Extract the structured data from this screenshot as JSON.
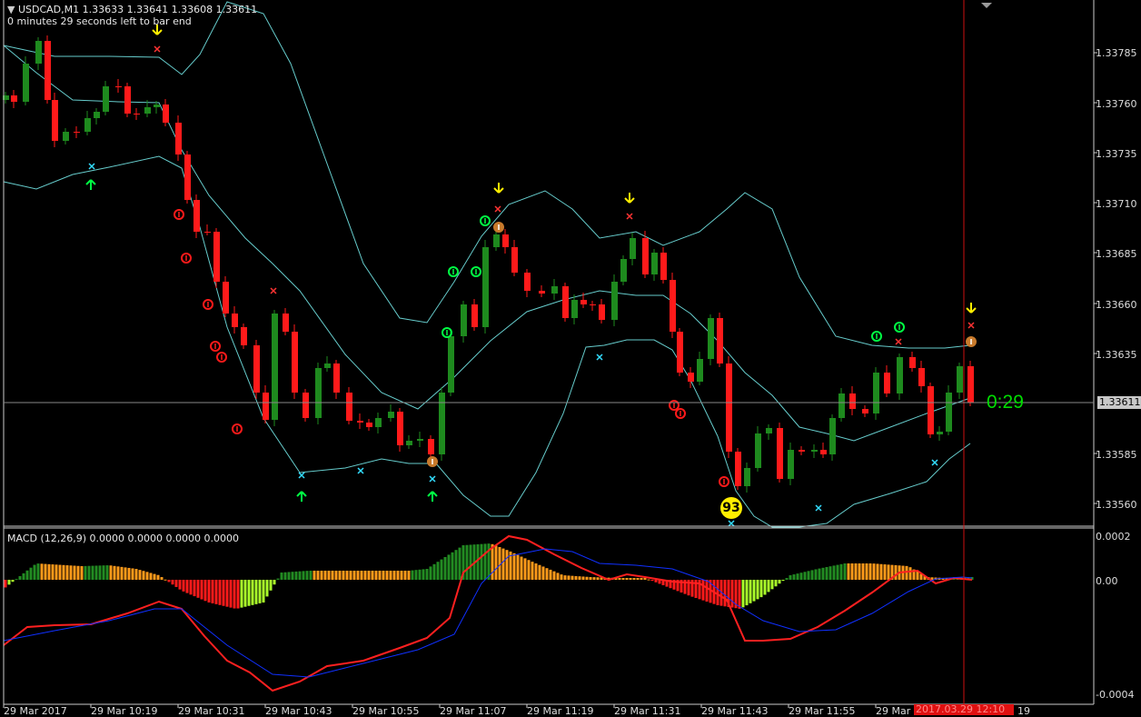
{
  "header": {
    "symbol_line": "USDCAD,M1  1.33633 1.33641 1.33608 1.33611",
    "countdown_text": "0 minutes 29 seconds left to bar end"
  },
  "price_scale": {
    "labels": [
      "1.33785",
      "1.33760",
      "1.33735",
      "1.33710",
      "1.33685",
      "1.33660",
      "1.33635",
      "1.33585",
      "1.33560"
    ],
    "current_price": "1.33611"
  },
  "timer_text": "0:29",
  "signal_badge": "93",
  "macd": {
    "label": "MACD (12,26,9) 0.0000 0.0000 0.0000 0.0000",
    "scale_labels": [
      "0.0002",
      "0.00",
      "-0.0004"
    ],
    "colors": {
      "up_strong": "#228B22",
      "up_weak": "#ff9a1a",
      "down_strong": "#ff1a1a",
      "down_weak": "#aaff2a",
      "signal_red": "#ff2020",
      "signal_blue": "#1030ff"
    }
  },
  "time_axis": {
    "labels": [
      "29 Mar 2017",
      "29 Mar 10:19",
      "29 Mar 10:31",
      "29 Mar 10:43",
      "29 Mar 10:55",
      "29 Mar 11:07",
      "29 Mar 11:19",
      "29 Mar 11:31",
      "29 Mar 11:43",
      "29 Mar 11:55",
      "29 Mar"
    ],
    "current_time": "2017.03.29 12:10",
    "tail_label": "19"
  },
  "colors": {
    "bull": "#1e8a1e",
    "bear": "#ff1a1a",
    "band": "#66cccc",
    "arrow_up": "#00ff44",
    "arrow_down": "#ffee00",
    "star_sell": "#ff3333",
    "star_buy": "#33ddff"
  },
  "icons": [
    "up-arrow-icon",
    "down-arrow-icon",
    "x-marker-icon",
    "signal-circle-icon"
  ]
}
